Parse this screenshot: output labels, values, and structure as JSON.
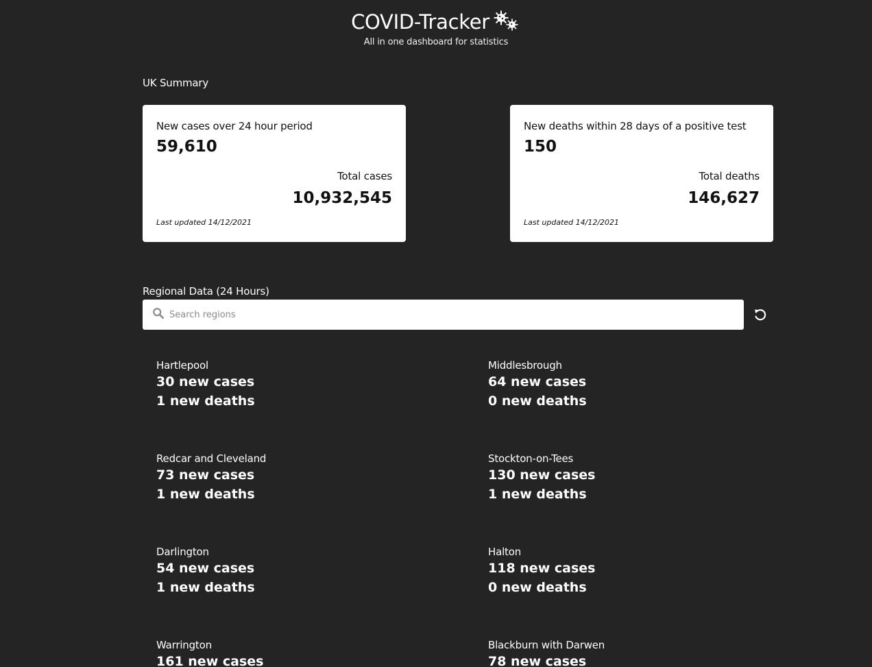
{
  "header": {
    "title": "COVID-Tracker",
    "subtitle": "All in one dashboard for statistics"
  },
  "summary": {
    "label": "UK Summary",
    "cases_card": {
      "title": "New cases over 24 hour period",
      "value": "59,610",
      "total_label": "Total cases",
      "total_value": "10,932,545",
      "updated": "Last updated 14/12/2021"
    },
    "deaths_card": {
      "title": "New deaths within 28 days of a positive test",
      "value": "150",
      "total_label": "Total deaths",
      "total_value": "146,627",
      "updated": "Last updated 14/12/2021"
    }
  },
  "regional": {
    "label": "Regional Data (24 Hours)",
    "search_placeholder": "Search regions",
    "regions": [
      {
        "name": "Hartlepool",
        "cases": "30 new cases",
        "deaths": "1 new deaths"
      },
      {
        "name": "Middlesbrough",
        "cases": "64 new cases",
        "deaths": "0 new deaths"
      },
      {
        "name": "Redcar and Cleveland",
        "cases": "73 new cases",
        "deaths": "1 new deaths"
      },
      {
        "name": "Stockton-on-Tees",
        "cases": "130 new cases",
        "deaths": "1 new deaths"
      },
      {
        "name": "Darlington",
        "cases": "54 new cases",
        "deaths": "1 new deaths"
      },
      {
        "name": "Halton",
        "cases": "118 new cases",
        "deaths": "0 new deaths"
      },
      {
        "name": "Warrington",
        "cases": "161 new cases",
        "deaths": ""
      },
      {
        "name": "Blackburn with Darwen",
        "cases": "78 new cases",
        "deaths": ""
      }
    ]
  },
  "icons": {
    "logo": "virus-icon",
    "search": "search-icon",
    "reset": "reset-icon"
  }
}
